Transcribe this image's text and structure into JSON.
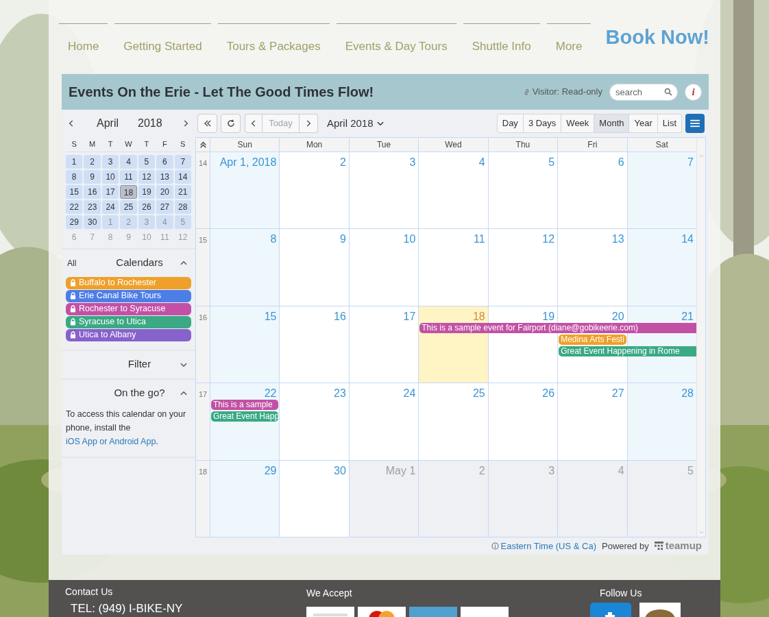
{
  "nav": {
    "items": [
      {
        "label": "Home"
      },
      {
        "label": "Getting Started"
      },
      {
        "label": "Tours & Packages"
      },
      {
        "label": "Events & Day Tours"
      },
      {
        "label": "Shuttle Info"
      },
      {
        "label": "More"
      }
    ],
    "book_button": "Book Now!"
  },
  "calendar": {
    "title": "Events On the Erie - Let The Good Times Flow!",
    "visitor": "Visitor: Read-only",
    "search": {
      "placeholder": "search"
    },
    "info_button": "i",
    "mini": {
      "month": "April",
      "year": "2018",
      "weekdays": [
        "S",
        "M",
        "T",
        "W",
        "T",
        "F",
        "S"
      ],
      "days": [
        {
          "label": "1",
          "kind": "month",
          "selected": false
        },
        {
          "label": "2",
          "kind": "month",
          "selected": false
        },
        {
          "label": "3",
          "kind": "month",
          "selected": false
        },
        {
          "label": "4",
          "kind": "month",
          "selected": false
        },
        {
          "label": "5",
          "kind": "month",
          "selected": false
        },
        {
          "label": "6",
          "kind": "month",
          "selected": false
        },
        {
          "label": "7",
          "kind": "month",
          "selected": false
        },
        {
          "label": "8",
          "kind": "month",
          "selected": false
        },
        {
          "label": "9",
          "kind": "month",
          "selected": false
        },
        {
          "label": "10",
          "kind": "month",
          "selected": false
        },
        {
          "label": "11",
          "kind": "month",
          "selected": false
        },
        {
          "label": "12",
          "kind": "month",
          "selected": false
        },
        {
          "label": "13",
          "kind": "month",
          "selected": false
        },
        {
          "label": "14",
          "kind": "month",
          "selected": false
        },
        {
          "label": "15",
          "kind": "month",
          "selected": false
        },
        {
          "label": "16",
          "kind": "month",
          "selected": false
        },
        {
          "label": "17",
          "kind": "month",
          "selected": false
        },
        {
          "label": "18",
          "kind": "month",
          "selected": true
        },
        {
          "label": "19",
          "kind": "month",
          "selected": false
        },
        {
          "label": "20",
          "kind": "month",
          "selected": false
        },
        {
          "label": "21",
          "kind": "month",
          "selected": false
        },
        {
          "label": "22",
          "kind": "month",
          "selected": false
        },
        {
          "label": "23",
          "kind": "month",
          "selected": false
        },
        {
          "label": "24",
          "kind": "month",
          "selected": false
        },
        {
          "label": "25",
          "kind": "month",
          "selected": false
        },
        {
          "label": "26",
          "kind": "month",
          "selected": false
        },
        {
          "label": "27",
          "kind": "month",
          "selected": false
        },
        {
          "label": "28",
          "kind": "month",
          "selected": false
        },
        {
          "label": "29",
          "kind": "month",
          "selected": false
        },
        {
          "label": "30",
          "kind": "month",
          "selected": false
        },
        {
          "label": "1",
          "kind": "adjacent",
          "selected": false
        },
        {
          "label": "2",
          "kind": "adjacent",
          "selected": false
        },
        {
          "label": "3",
          "kind": "adjacent",
          "selected": false
        },
        {
          "label": "4",
          "kind": "adjacent",
          "selected": false
        },
        {
          "label": "5",
          "kind": "adjacent",
          "selected": false
        },
        {
          "label": "6",
          "kind": "outside",
          "selected": false
        },
        {
          "label": "7",
          "kind": "outside",
          "selected": false
        },
        {
          "label": "8",
          "kind": "outside",
          "selected": false
        },
        {
          "label": "9",
          "kind": "outside",
          "selected": false
        },
        {
          "label": "10",
          "kind": "outside",
          "selected": false
        },
        {
          "label": "11",
          "kind": "outside",
          "selected": false
        },
        {
          "label": "12",
          "kind": "outside",
          "selected": false
        }
      ]
    },
    "toolbar": {
      "today": {
        "label": "Today",
        "disabled": true
      },
      "period": "April 2018",
      "views": [
        {
          "label": "Day",
          "selected": false
        },
        {
          "label": "3 Days",
          "selected": false
        },
        {
          "label": "Week",
          "selected": false
        },
        {
          "label": "Month",
          "selected": true
        },
        {
          "label": "Year",
          "selected": false
        },
        {
          "label": "List",
          "selected": false
        }
      ]
    },
    "sections": [
      {
        "kind": "calendars",
        "title": "Calendars",
        "all": "All",
        "expanded": true,
        "items": [
          {
            "label": "Buffalo to Rochester",
            "color": "#eea02a"
          },
          {
            "label": "Erie Canal Bike Tours",
            "color": "#4d7de6"
          },
          {
            "label": "Rochester to Syracuse",
            "color": "#c251a5"
          },
          {
            "label": "Syracuse to Utica",
            "color": "#3aa984"
          },
          {
            "label": "Utica to Albany",
            "color": "#8761cc"
          }
        ]
      },
      {
        "kind": "filter",
        "title": "Filter",
        "expanded": false
      },
      {
        "kind": "info",
        "title": "On the go?",
        "expanded": true,
        "text": "To access this calendar on your phone, install the",
        "link": "iOS App or Android App",
        "end": "."
      }
    ],
    "grid": {
      "weekdays": [
        "Sun",
        "Mon",
        "Tue",
        "Wed",
        "Thu",
        "Fri",
        "Sat"
      ],
      "weeks": [
        {
          "number": "14",
          "days": [
            {
              "label": "Apr 1, 2018",
              "kind": "weekend"
            },
            {
              "label": "2",
              "kind": "weekday"
            },
            {
              "label": "3",
              "kind": "weekday"
            },
            {
              "label": "4",
              "kind": "weekday"
            },
            {
              "label": "5",
              "kind": "weekday"
            },
            {
              "label": "6",
              "kind": "weekday"
            },
            {
              "label": "7",
              "kind": "weekend"
            }
          ]
        },
        {
          "number": "15",
          "days": [
            {
              "label": "8",
              "kind": "weekend"
            },
            {
              "label": "9",
              "kind": "weekday"
            },
            {
              "label": "10",
              "kind": "weekday"
            },
            {
              "label": "11",
              "kind": "weekday"
            },
            {
              "label": "12",
              "kind": "weekday"
            },
            {
              "label": "13",
              "kind": "weekday"
            },
            {
              "label": "14",
              "kind": "weekend"
            }
          ]
        },
        {
          "number": "16",
          "days": [
            {
              "label": "15",
              "kind": "weekend"
            },
            {
              "label": "16",
              "kind": "weekday"
            },
            {
              "label": "17",
              "kind": "weekday"
            },
            {
              "label": "18",
              "kind": "today",
              "events": [
                {
                  "title": "This is a sample event for Fairport (diane@gobikeerie.com)",
                  "color": "#c251a5",
                  "to_week_end": true
                }
              ]
            },
            {
              "label": "19",
              "kind": "weekday"
            },
            {
              "label": "20",
              "kind": "weekday",
              "events": [
                {
                  "title": "Medina Arts Festi",
                  "color": "#eea02a",
                  "to_week_end": false
                },
                {
                  "title": "Great Event Happening in Rome",
                  "color": "#3aa984",
                  "to_week_end": true
                }
              ]
            },
            {
              "label": "21",
              "kind": "weekend"
            }
          ]
        },
        {
          "number": "17",
          "days": [
            {
              "label": "22",
              "kind": "weekend",
              "events": [
                {
                  "title": "This is a sample",
                  "color": "#c251a5",
                  "to_week_end": false
                },
                {
                  "title": "Great Event Happ",
                  "color": "#3aa984",
                  "to_week_end": false
                }
              ]
            },
            {
              "label": "23",
              "kind": "weekday"
            },
            {
              "label": "24",
              "kind": "weekday"
            },
            {
              "label": "25",
              "kind": "weekday"
            },
            {
              "label": "26",
              "kind": "weekday"
            },
            {
              "label": "27",
              "kind": "weekday"
            },
            {
              "label": "28",
              "kind": "weekend"
            }
          ]
        },
        {
          "number": "18",
          "days": [
            {
              "label": "29",
              "kind": "weekend"
            },
            {
              "label": "30",
              "kind": "weekday"
            },
            {
              "label": "May 1",
              "kind": "other"
            },
            {
              "label": "2",
              "kind": "other"
            },
            {
              "label": "3",
              "kind": "other"
            },
            {
              "label": "4",
              "kind": "other"
            },
            {
              "label": "5",
              "kind": "other"
            }
          ]
        }
      ]
    },
    "footer_bar": {
      "timezone": "Eastern Time (US & Ca)",
      "powered_by": "Powered by",
      "brand": "teamup"
    }
  },
  "footer": {
    "contact": {
      "title": "Contact Us",
      "phone": "TEL: (949) I-BIKE-NY"
    },
    "payment": {
      "title": "We Accept"
    },
    "social": {
      "title": "Follow Us"
    }
  }
}
